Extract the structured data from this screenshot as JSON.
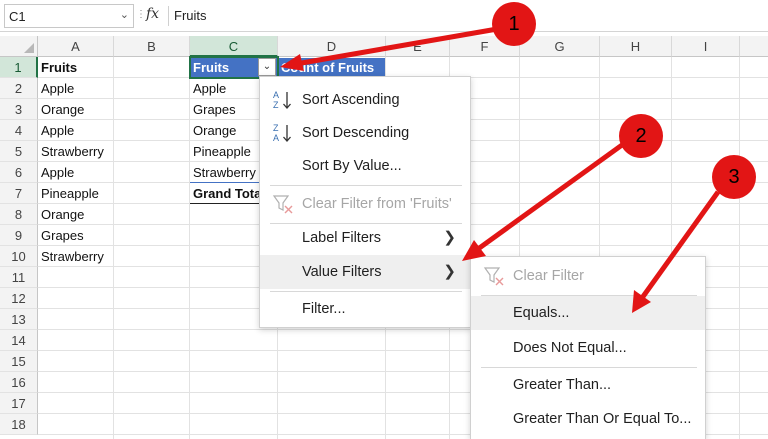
{
  "formula_bar": {
    "name_box": "C1",
    "fx_label": "fx",
    "content": "Fruits"
  },
  "columns": [
    "A",
    "B",
    "C",
    "D",
    "E",
    "F",
    "G",
    "H",
    "I"
  ],
  "selected_column": "C",
  "rows": [
    "1",
    "2",
    "3",
    "4",
    "5",
    "6",
    "7",
    "8",
    "9",
    "10",
    "11",
    "12",
    "13",
    "14",
    "15",
    "16",
    "17",
    "18"
  ],
  "selected_row": "1",
  "column_a": [
    "Fruits",
    "Apple",
    "Orange",
    "Apple",
    "Strawberry",
    "Apple",
    "Pineapple",
    "Orange",
    "Grapes",
    "Strawberry"
  ],
  "pivot": {
    "header_row_label": "Fruits",
    "header_count": "Count of Fruits",
    "items": [
      "Apple",
      "Grapes",
      "Orange",
      "Pineapple",
      "Strawberry"
    ],
    "grand_total": "Grand Total"
  },
  "filter_menu": {
    "items": [
      {
        "label": "Sort Ascending",
        "icon": "sort-ascending-icon",
        "enabled": true
      },
      {
        "label": "Sort Descending",
        "icon": "sort-descending-icon",
        "enabled": true
      },
      {
        "label": "Sort By Value...",
        "icon": "",
        "enabled": true
      },
      {
        "label": "Clear Filter from 'Fruits'",
        "icon": "clear-filter-icon",
        "enabled": false
      },
      {
        "label": "Label Filters",
        "icon": "",
        "enabled": true,
        "submenu": true
      },
      {
        "label": "Value Filters",
        "icon": "",
        "enabled": true,
        "submenu": true,
        "highlighted": true
      },
      {
        "label": "Filter...",
        "icon": "",
        "enabled": true
      }
    ]
  },
  "value_filters_submenu": {
    "items": [
      {
        "label": "Clear Filter",
        "icon": "clear-filter-icon",
        "enabled": false
      },
      {
        "label": "Equals...",
        "enabled": true,
        "highlighted": true
      },
      {
        "label": "Does Not Equal...",
        "enabled": true
      },
      {
        "label": "Greater Than...",
        "enabled": true
      },
      {
        "label": "Greater Than Or Equal To...",
        "enabled": true
      }
    ]
  },
  "annotations": {
    "badges": [
      "1",
      "2",
      "3"
    ],
    "color": "#e21515"
  },
  "colors": {
    "excel_green": "#217346",
    "pivot_header_blue": "#4472c4",
    "menu_highlight": "#efefef"
  }
}
